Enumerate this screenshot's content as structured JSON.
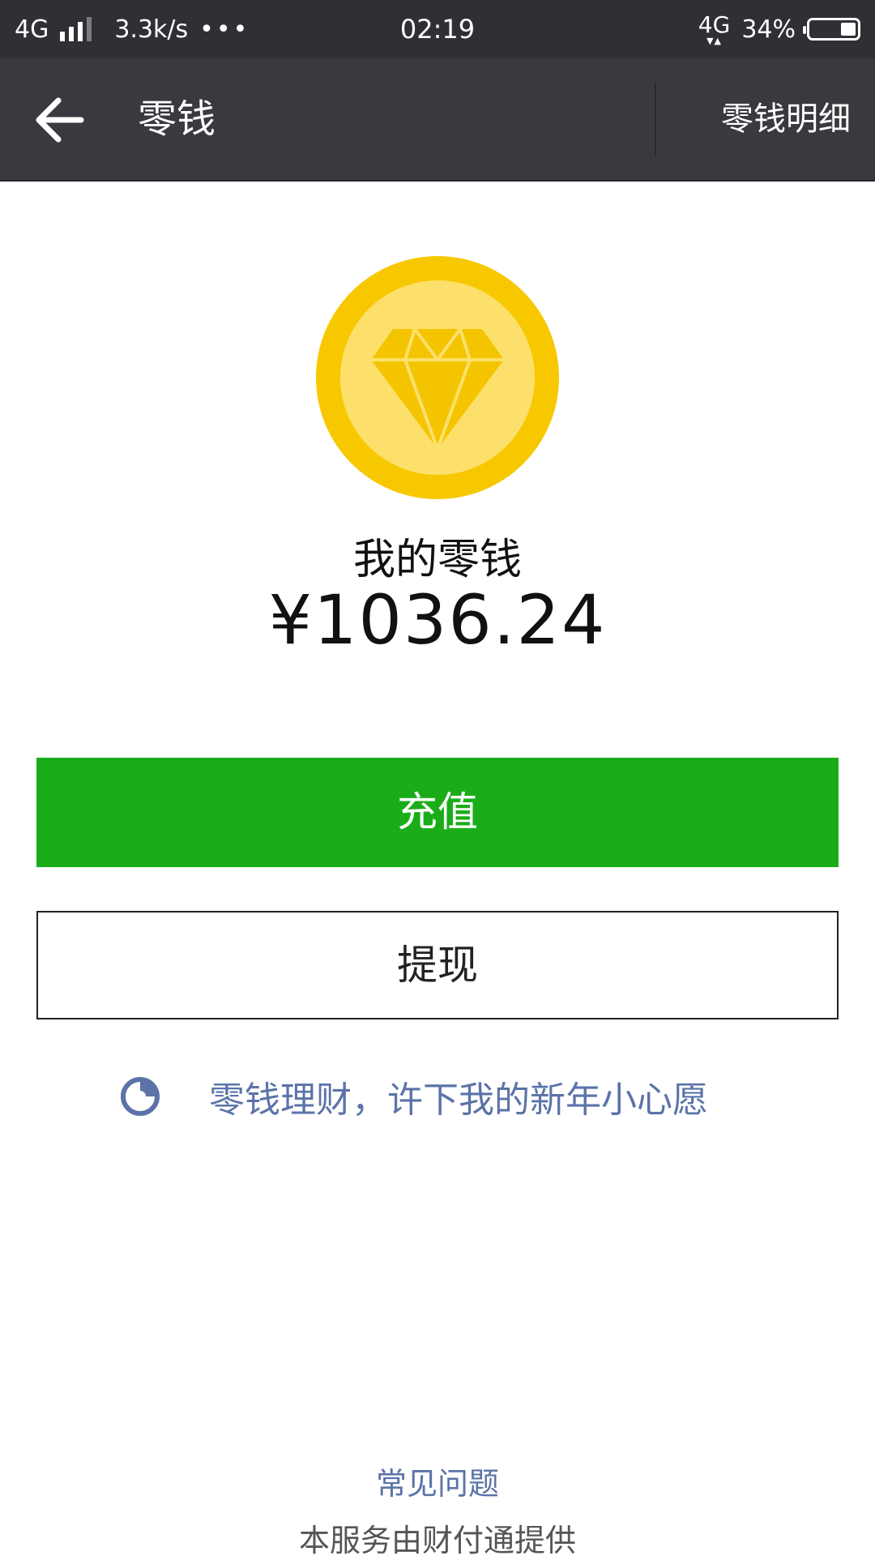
{
  "status_bar": {
    "network_left": "4G",
    "speed": "3.3k/s",
    "dots": "•••",
    "time": "02:19",
    "network_right": "4G",
    "battery": "34%"
  },
  "header": {
    "title": "零钱",
    "detail_link": "零钱明细"
  },
  "balance": {
    "label": "我的零钱",
    "amount": "¥1036.24"
  },
  "buttons": {
    "recharge": "充值",
    "withdraw": "提现"
  },
  "promo": {
    "text": "零钱理财，许下我的新年小心愿"
  },
  "footer": {
    "faq": "常见问题",
    "provider": "本服务由财付通提供"
  },
  "colors": {
    "status_bar": "#2e3034",
    "header": "#393a3f",
    "coin_outer": "#f7c800",
    "coin_inner": "#fce06b",
    "primary_green": "#1aad19",
    "link_blue": "#5b73a8"
  }
}
